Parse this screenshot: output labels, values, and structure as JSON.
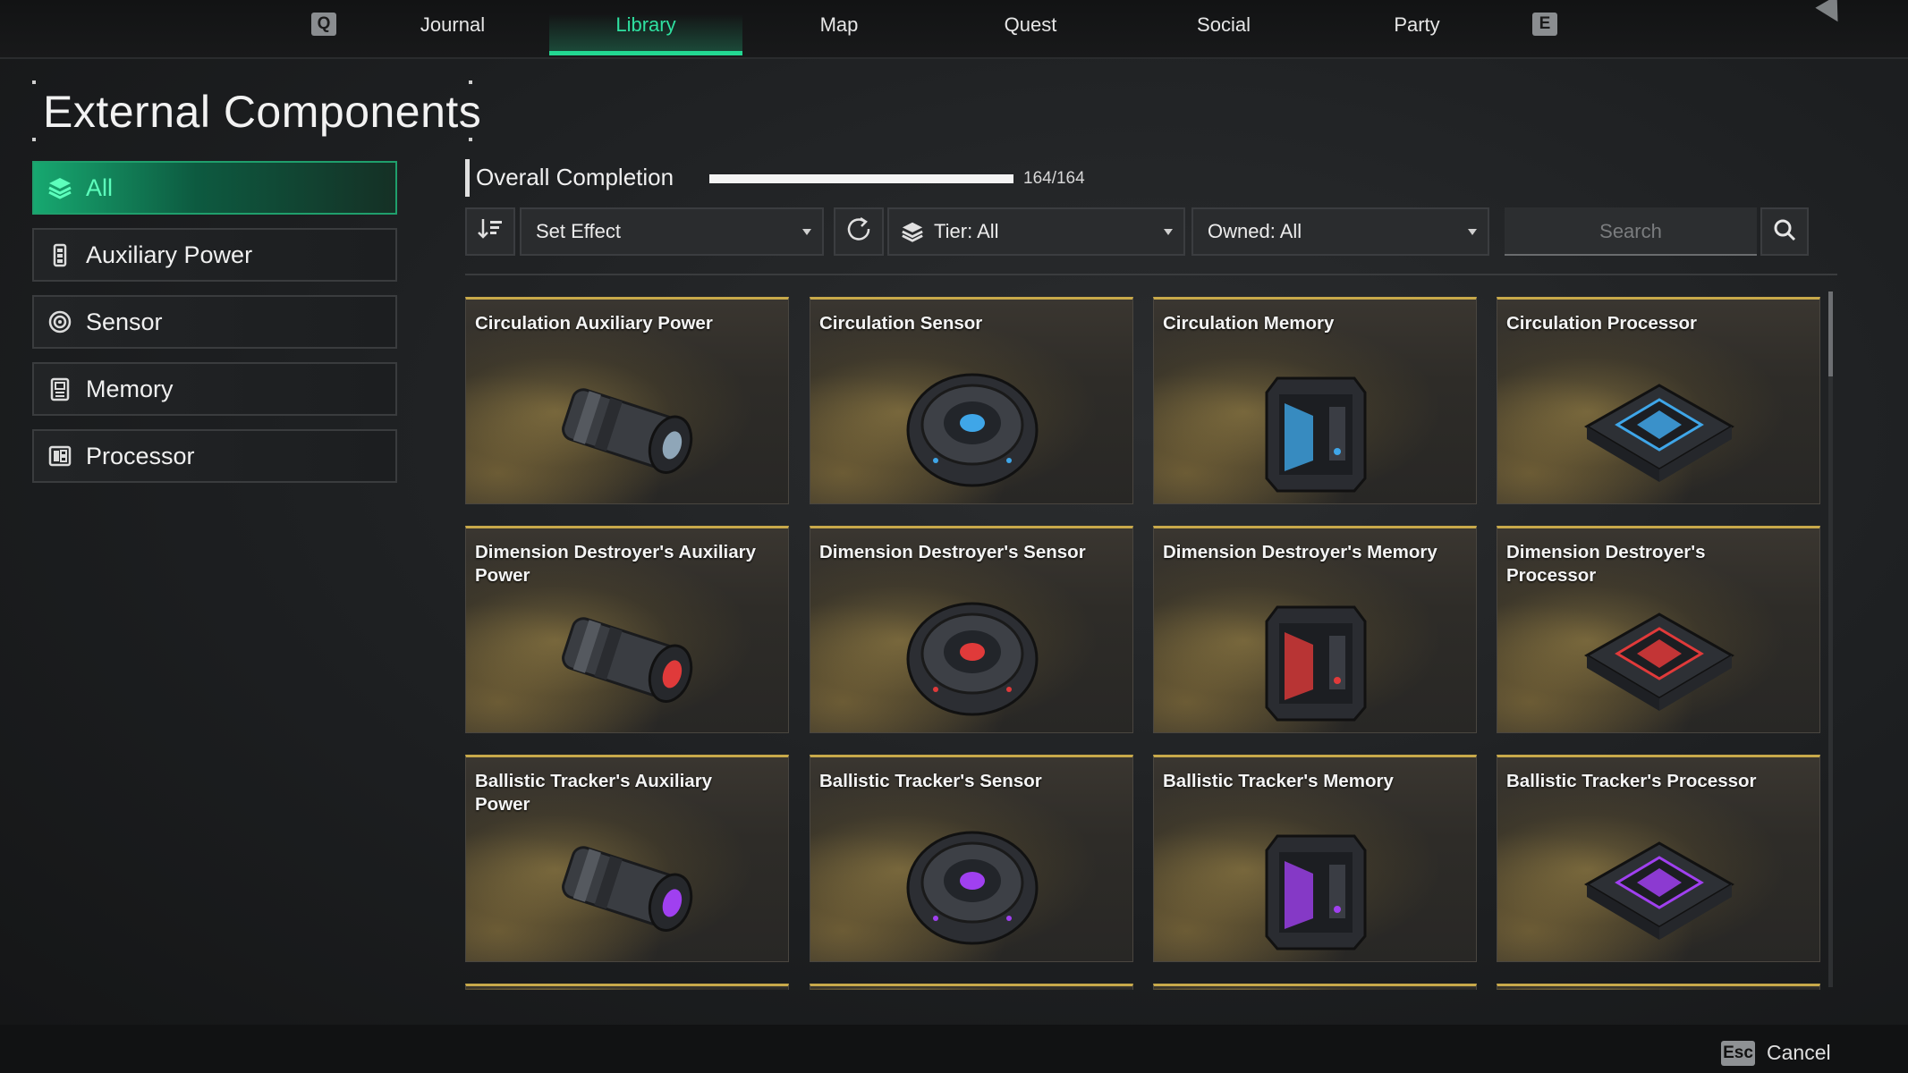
{
  "nav": {
    "left_key": "Q",
    "right_key": "E",
    "tabs": [
      {
        "label": "Journal",
        "active": false
      },
      {
        "label": "Library",
        "active": true
      },
      {
        "label": "Map",
        "active": false
      },
      {
        "label": "Quest",
        "active": false
      },
      {
        "label": "Social",
        "active": false
      },
      {
        "label": "Party",
        "active": false
      }
    ]
  },
  "page_title": "External Components",
  "sidebar": {
    "items": [
      {
        "label": "All",
        "icon": "layers-icon",
        "active": true
      },
      {
        "label": "Auxiliary Power",
        "icon": "battery-icon",
        "active": false
      },
      {
        "label": "Sensor",
        "icon": "sensor-icon",
        "active": false
      },
      {
        "label": "Memory",
        "icon": "memory-icon",
        "active": false
      },
      {
        "label": "Processor",
        "icon": "processor-icon",
        "active": false
      }
    ]
  },
  "completion": {
    "label": "Overall Completion",
    "text": "164/164",
    "fraction": 1.0
  },
  "filters": {
    "sort_icon": "sort-icon",
    "set_effect": "Set Effect",
    "reset_icon": "refresh-icon",
    "tier": "Tier: All",
    "owned": "Owned: All",
    "search_placeholder": "Search"
  },
  "items": [
    {
      "name": "Circulation Auxiliary Power",
      "type": "auxiliary",
      "accent": "#8fa6b8"
    },
    {
      "name": "Circulation Sensor",
      "type": "sensor",
      "accent": "#3fa6e8"
    },
    {
      "name": "Circulation Memory",
      "type": "memory",
      "accent": "#3fa6e8"
    },
    {
      "name": "Circulation Processor",
      "type": "processor",
      "accent": "#3fa6e8"
    },
    {
      "name": "Dimension Destroyer's Auxiliary Power",
      "type": "auxiliary",
      "accent": "#e03a3a"
    },
    {
      "name": "Dimension Destroyer's Sensor",
      "type": "sensor",
      "accent": "#e03a3a"
    },
    {
      "name": "Dimension Destroyer's Memory",
      "type": "memory",
      "accent": "#e03a3a"
    },
    {
      "name": "Dimension Destroyer's Processor",
      "type": "processor",
      "accent": "#e03a3a"
    },
    {
      "name": "Ballistic Tracker's Auxiliary Power",
      "type": "auxiliary",
      "accent": "#a040f0"
    },
    {
      "name": "Ballistic Tracker's Sensor",
      "type": "sensor",
      "accent": "#a040f0"
    },
    {
      "name": "Ballistic Tracker's Memory",
      "type": "memory",
      "accent": "#a040f0"
    },
    {
      "name": "Ballistic Tracker's Processor",
      "type": "processor",
      "accent": "#a040f0"
    }
  ],
  "footer": {
    "key": "Esc",
    "label": "Cancel"
  },
  "colors": {
    "accent_green": "#23d892",
    "card_border_gold": "#c8a94a"
  }
}
